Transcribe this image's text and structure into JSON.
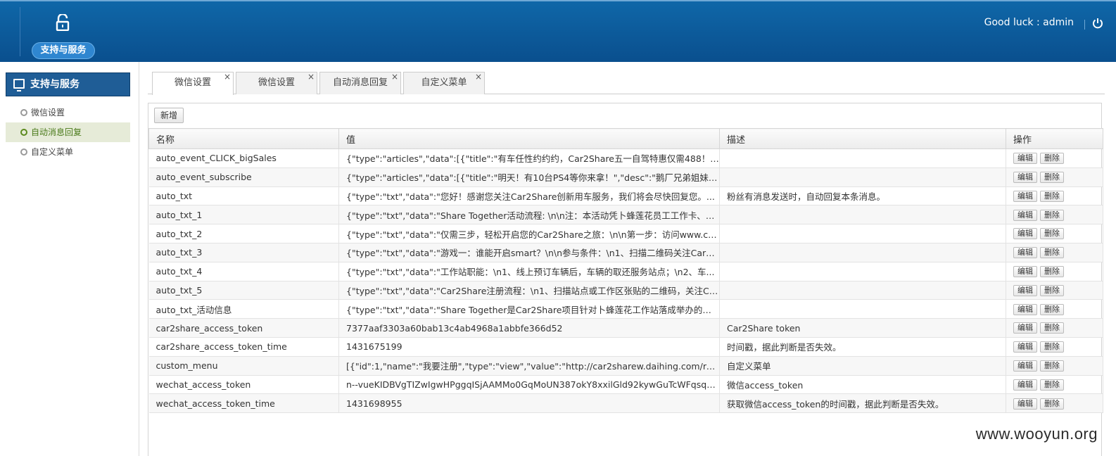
{
  "header": {
    "badge": "支持与服务",
    "greeting": "Good luck : admin"
  },
  "sidebar": {
    "title": "支持与服务",
    "items": [
      {
        "label": "微信设置",
        "active": false
      },
      {
        "label": "自动消息回复",
        "active": true
      },
      {
        "label": "自定义菜单",
        "active": false
      }
    ]
  },
  "tabs": [
    {
      "label": "微信设置",
      "close": "×"
    },
    {
      "label": "微信设置",
      "close": "×"
    },
    {
      "label": "自动消息回复",
      "close": "×"
    },
    {
      "label": "自定义菜单",
      "close": "×"
    }
  ],
  "toolbar": {
    "add_label": "新增"
  },
  "table": {
    "columns": [
      "名称",
      "值",
      "描述",
      "操作"
    ],
    "edit_label": "编辑",
    "delete_label": "删除",
    "rows": [
      {
        "name": "auto_event_CLICK_bigSales",
        "value": "{\"type\":\"articles\",\"data\":[{\"title\":\"有车任性约约约，Car2Share五一自驾特惠仅需488！\",\"d...",
        "desc": ""
      },
      {
        "name": "auto_event_subscribe",
        "value": "{\"type\":\"articles\",\"data\":[{\"title\":\"明天！有10台PS4等你来拿！\",\"desc\":\"鹅厂兄弟姐妹躁...",
        "desc": ""
      },
      {
        "name": "auto_txt",
        "value": "{\"type\":\"txt\",\"data\":\"您好！感谢您关注Car2Share创新用车服务，我们将会尽快回复您。...",
        "desc": "粉丝有消息发送时，自动回复本条消息。"
      },
      {
        "name": "auto_txt_1",
        "value": "{\"type\":\"txt\",\"data\":\"Share Together活动流程: \\n\\n注：本活动凭卜蜂莲花员工工作卡、驾...",
        "desc": ""
      },
      {
        "name": "auto_txt_2",
        "value": "{\"type\":\"txt\",\"data\":\"仅需三步，轻松开启您的Car2Share之旅：\\n\\n第一步：访问www.car...",
        "desc": ""
      },
      {
        "name": "auto_txt_3",
        "value": "{\"type\":\"txt\",\"data\":\"游戏一：谁能开启smart？\\n\\n参与条件：\\n1、扫描二维码关注Car2S...",
        "desc": ""
      },
      {
        "name": "auto_txt_4",
        "value": "{\"type\":\"txt\",\"data\":\"工作站职能：\\n1、线上预订车辆后，车辆的取还服务站点；\\n2、车...",
        "desc": ""
      },
      {
        "name": "auto_txt_5",
        "value": "{\"type\":\"txt\",\"data\":\"Car2Share注册流程：\\n1、扫描站点或工作区张贴的二维码，关注Ca...",
        "desc": ""
      },
      {
        "name": "auto_txt_活动信息",
        "value": "{\"type\":\"txt\",\"data\":\"Share Together是Car2Share项目针对卜蜂莲花工作站落成举办的庆祝...",
        "desc": ""
      },
      {
        "name": "car2share_access_token",
        "value": "7377aaf3303a60bab13c4ab4968a1abbfe366d52",
        "desc": "Car2Share token"
      },
      {
        "name": "car2share_access_token_time",
        "value": "1431675199",
        "desc": "时间戳，据此判断是否失效。"
      },
      {
        "name": "custom_menu",
        "value": "[{\"id\":1,\"name\":\"我要注册\",\"type\":\"view\",\"value\":\"http://car2sharew.daihing.com/register\"...",
        "desc": "自定义菜单"
      },
      {
        "name": "wechat_access_token",
        "value": "n--vueKIDBVgTIZwIgwHPggqISjAAMMo0GqMoUN387okY8xxilGld92kywGuTcWFqsq2dj...",
        "desc": "微信access_token"
      },
      {
        "name": "wechat_access_token_time",
        "value": "1431698955",
        "desc": "获取微信access_token的时间戳，据此判断是否失效。"
      }
    ]
  },
  "watermark": "www.wooyun.org"
}
